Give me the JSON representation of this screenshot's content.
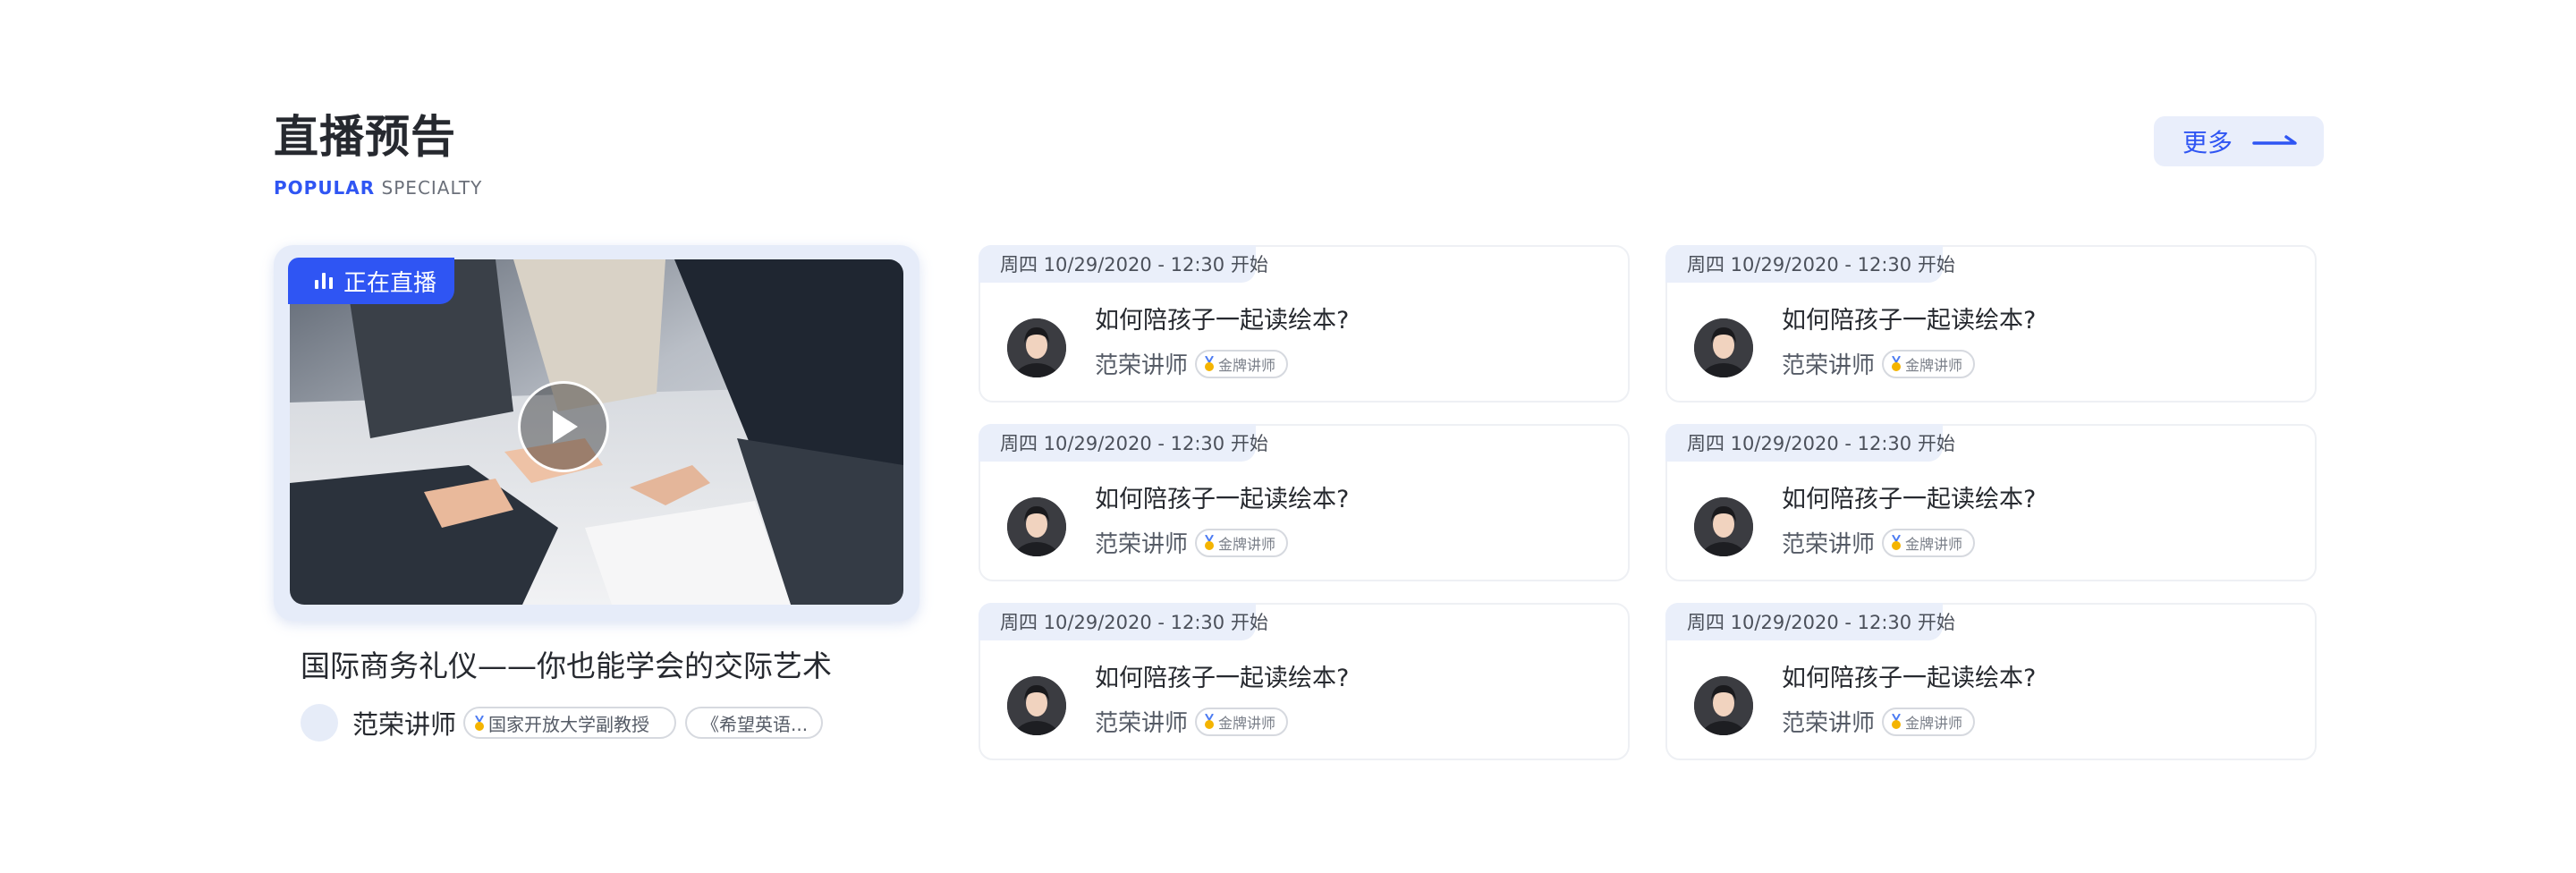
{
  "header": {
    "title": "直播预告",
    "subtitle_accent": "POPULAR",
    "subtitle_rest": "SPECIALTY",
    "more_label": "更多"
  },
  "featured": {
    "live_badge": "正在直播",
    "title": "国际商务礼仪——你也能学会的交际艺术",
    "lecturer": "范荣讲师",
    "tags": [
      "国家开放大学副教授",
      "《希望英语..."
    ],
    "image_label": "business-handshake-photo"
  },
  "cards": [
    {
      "date": "周四 10/29/2020 - 12:30 开始",
      "title": "如何陪孩子一起读绘本?",
      "lecturer": "范荣讲师",
      "badge": "金牌讲师"
    },
    {
      "date": "周四 10/29/2020 - 12:30 开始",
      "title": "如何陪孩子一起读绘本?",
      "lecturer": "范荣讲师",
      "badge": "金牌讲师"
    },
    {
      "date": "周四 10/29/2020 - 12:30 开始",
      "title": "如何陪孩子一起读绘本?",
      "lecturer": "范荣讲师",
      "badge": "金牌讲师"
    },
    {
      "date": "周四 10/29/2020 - 12:30 开始",
      "title": "如何陪孩子一起读绘本?",
      "lecturer": "范荣讲师",
      "badge": "金牌讲师"
    },
    {
      "date": "周四 10/29/2020 - 12:30 开始",
      "title": "如何陪孩子一起读绘本?",
      "lecturer": "范荣讲师",
      "badge": "金牌讲师"
    },
    {
      "date": "周四 10/29/2020 - 12:30 开始",
      "title": "如何陪孩子一起读绘本?",
      "lecturer": "范荣讲师",
      "badge": "金牌讲师"
    }
  ],
  "icons": {
    "live": "live-bars-icon",
    "play": "play-icon",
    "more": "arrow-right-icon",
    "badge": "medal-icon"
  },
  "colors": {
    "accent": "#2f55f3",
    "tag_bg": "#eaeffa",
    "text": "#26292f"
  }
}
